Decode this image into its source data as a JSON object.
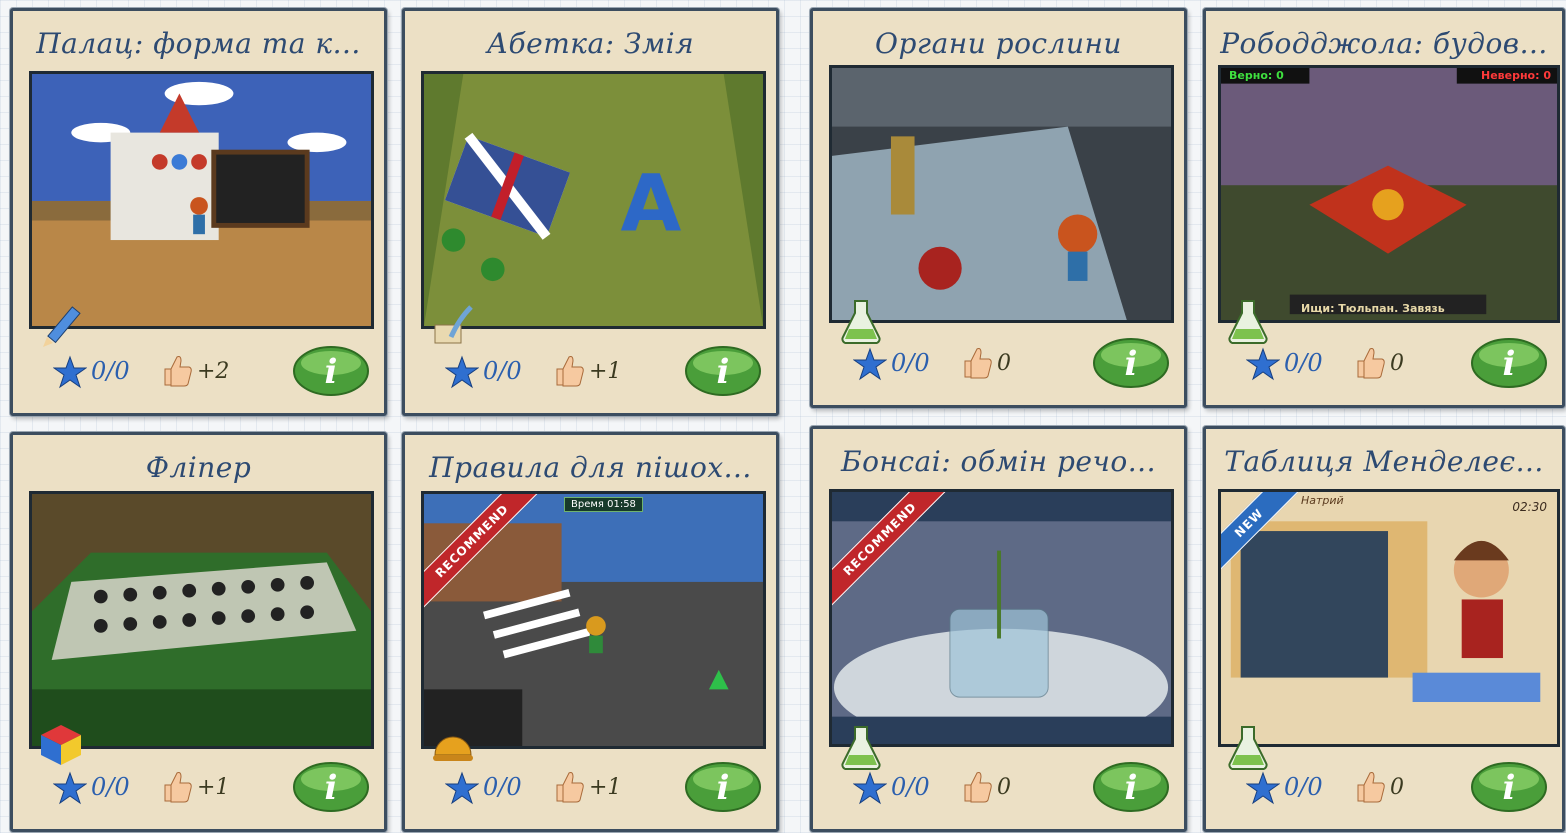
{
  "cards": [
    {
      "title": "Палац: форма та к...",
      "rating": "0/0",
      "likes": "+2",
      "category_icon": "pencil-icon"
    },
    {
      "title": "Абетка: Змія",
      "rating": "0/0",
      "likes": "+1",
      "category_icon": "quill-icon"
    },
    {
      "title": "Органи рослини",
      "rating": "0/0",
      "likes": "0",
      "category_icon": "flask-icon"
    },
    {
      "title": "Рободджола: будов...",
      "rating": "0/0",
      "likes": "0",
      "category_icon": "flask-icon",
      "hud_left": "Верно: 0",
      "hud_right": "Неверно: 0",
      "hud_bottom": "Ищи: Тюльпан. Завязь"
    },
    {
      "title": "Фліпер",
      "rating": "0/0",
      "likes": "+1",
      "category_icon": "rubiks-cube-icon"
    },
    {
      "title": "Правила для пішох...",
      "rating": "0/0",
      "likes": "+1",
      "category_icon": "helmet-icon",
      "badge": "RECOMMEND",
      "hud_time": "Время 01:58"
    },
    {
      "title": "Бонсаі: обмін рeчо...",
      "rating": "0/0",
      "likes": "0",
      "category_icon": "flask-icon",
      "badge": "RECOMMEND"
    },
    {
      "title": "Таблиця Менделеє...",
      "rating": "0/0",
      "likes": "0",
      "category_icon": "flask-icon",
      "badge": "NEW",
      "hud_time": "02:30",
      "element_name": "Натрий"
    }
  ],
  "colors": {
    "card_bg": "#ece0c5",
    "title": "#2d4a72",
    "rating": "#2b5fae",
    "info_green": "#4a9e3a"
  }
}
